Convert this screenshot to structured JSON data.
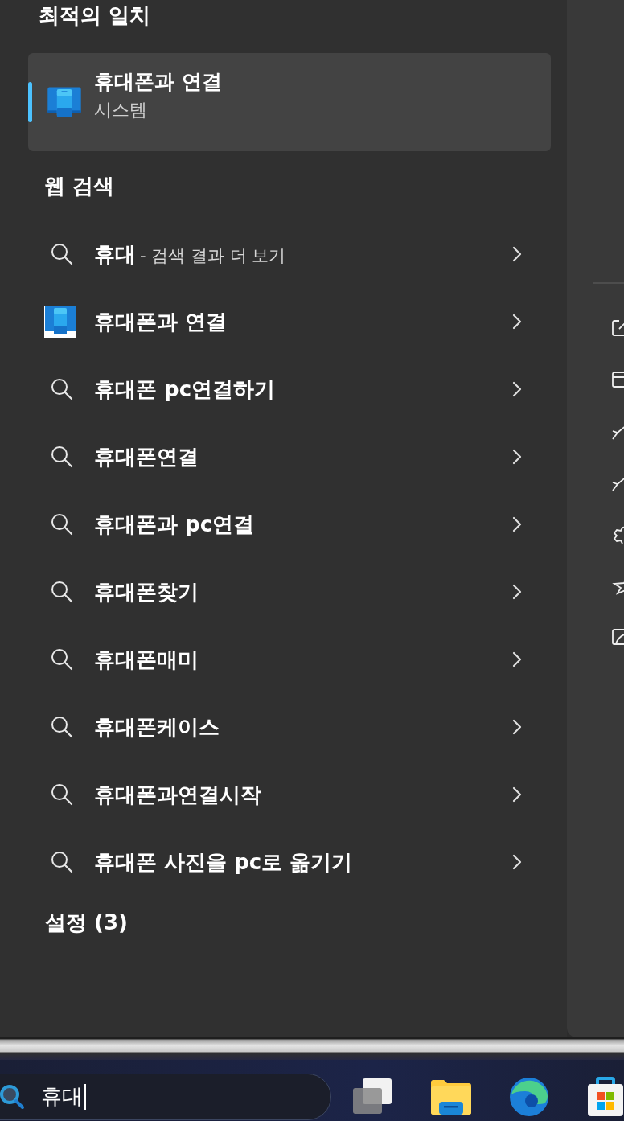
{
  "best_match": {
    "heading": "최적의 일치",
    "item": {
      "title": "휴대폰과 연결",
      "subtitle": "시스템",
      "selected": true
    }
  },
  "web_search": {
    "heading": "웹 검색",
    "items": [
      {
        "kind": "more",
        "query": "휴대",
        "suffix": "- 검색 결과 더 보기"
      },
      {
        "kind": "app",
        "query": "휴대폰과 연결"
      },
      {
        "kind": "search",
        "query": "휴대폰 pc연결하기"
      },
      {
        "kind": "search",
        "query": "휴대폰연결"
      },
      {
        "kind": "search",
        "query": "휴대폰과 pc연결"
      },
      {
        "kind": "search",
        "query": "휴대폰찾기"
      },
      {
        "kind": "search",
        "query": "휴대폰매미"
      },
      {
        "kind": "search",
        "query": "휴대폰케이스"
      },
      {
        "kind": "search",
        "query": "휴대폰과연결시작"
      },
      {
        "kind": "search",
        "query": "휴대폰 사진을 pc로 옮기기"
      }
    ]
  },
  "settings": {
    "heading": "설정 (3)"
  },
  "taskbar": {
    "search": {
      "value": "휴대"
    }
  }
}
